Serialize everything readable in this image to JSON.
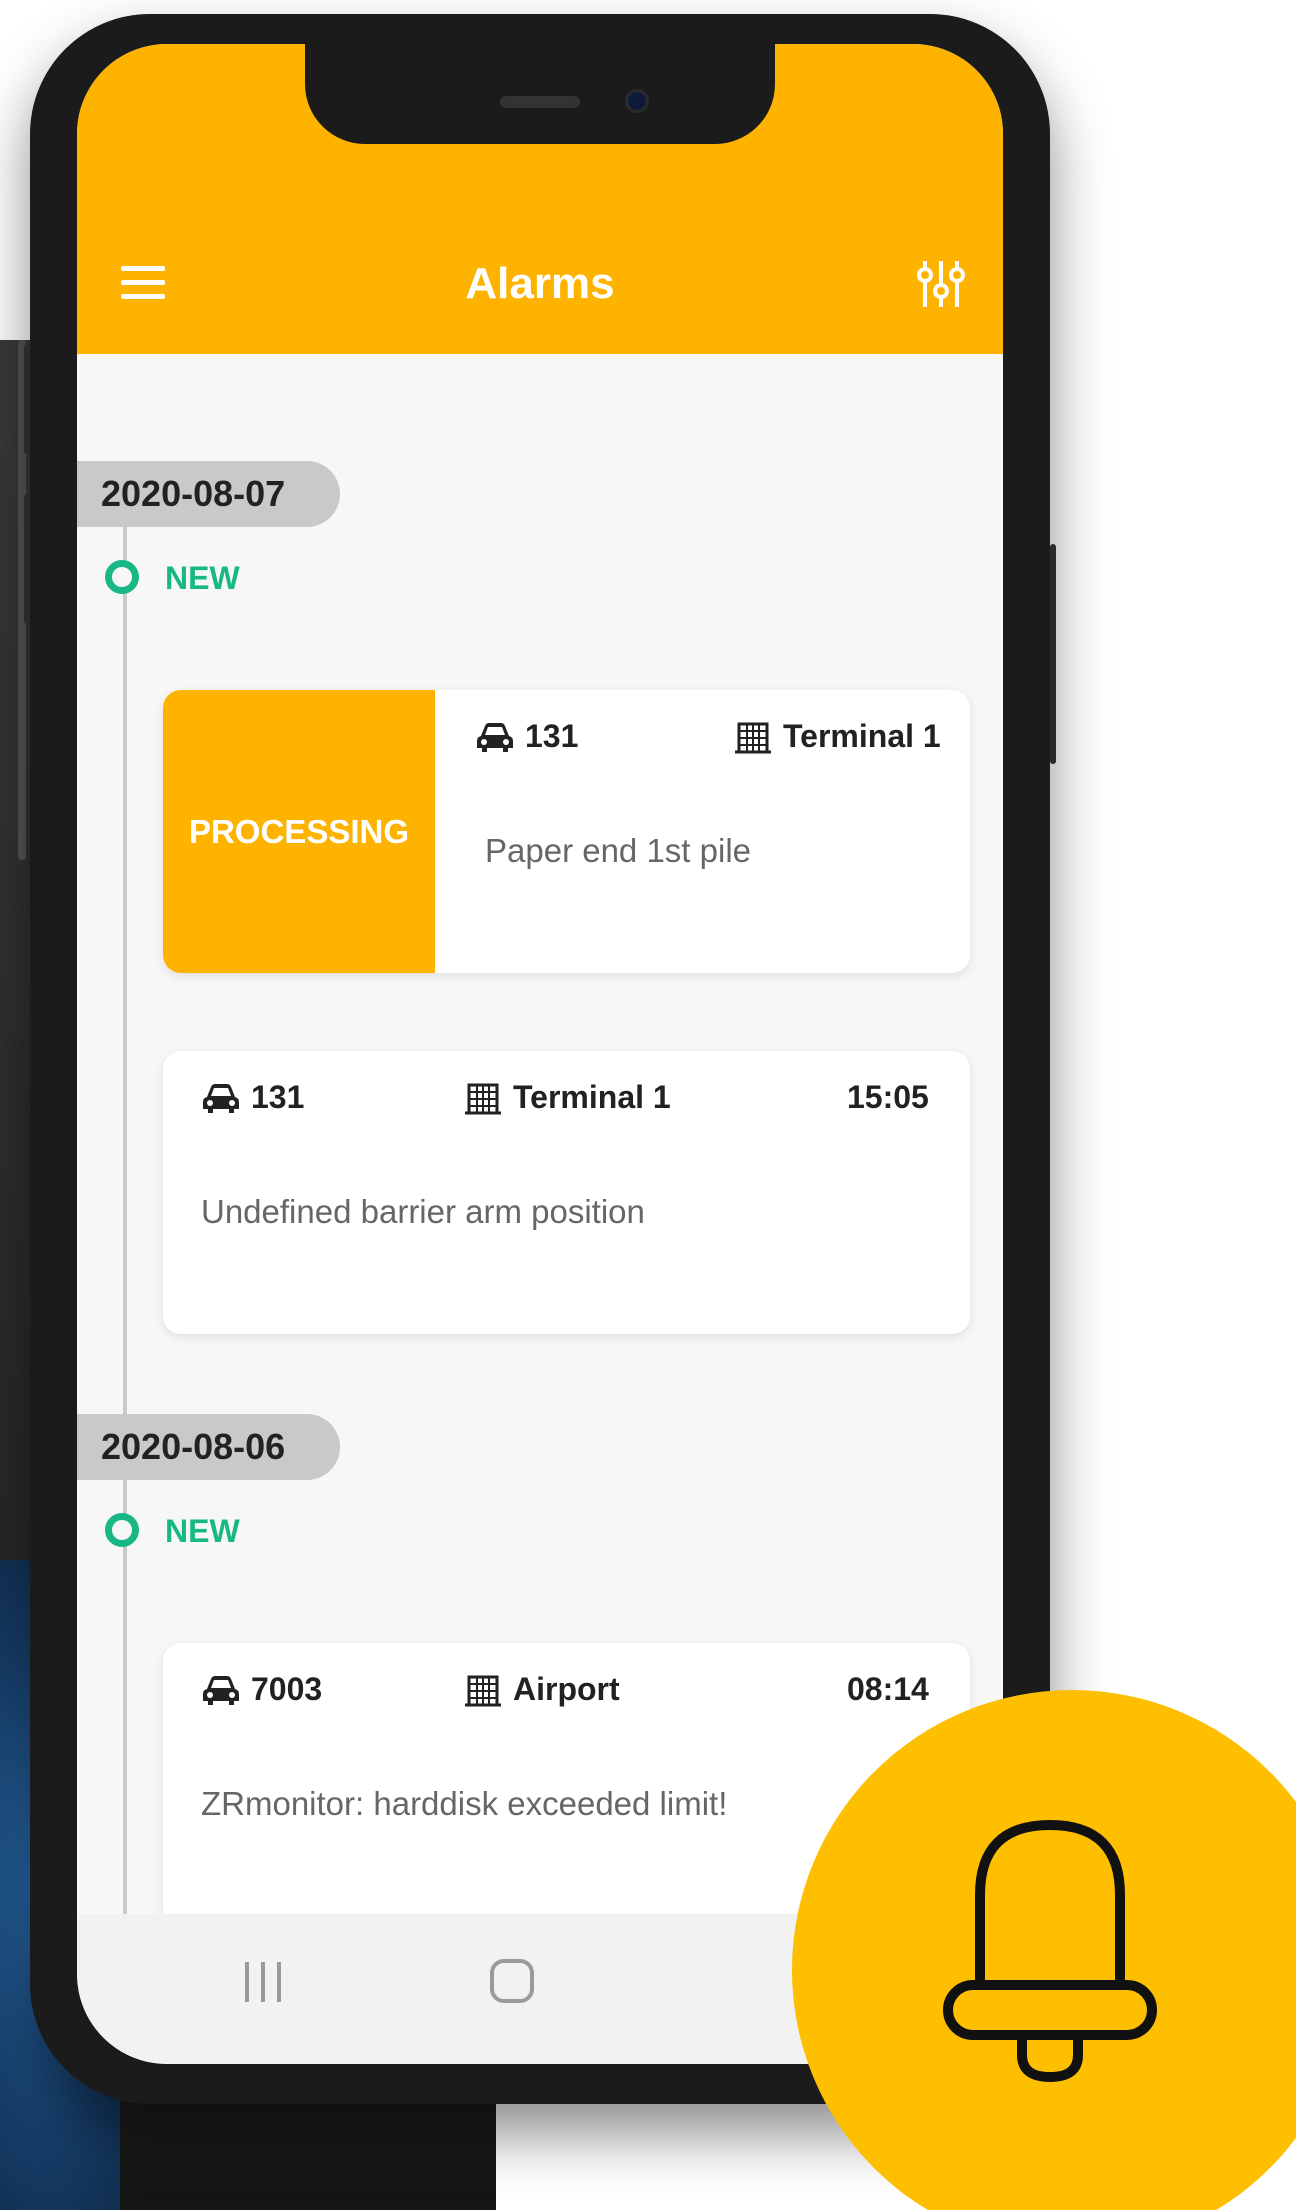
{
  "app": {
    "title": "Alarms",
    "accent_color": "#FDB300",
    "new_color": "#17B886"
  },
  "header": {
    "menu_icon": "hamburger-menu-icon",
    "filter_icon": "sliders-filter-icon"
  },
  "groups": [
    {
      "date": "2020-08-07",
      "status": "NEW",
      "cards": [
        {
          "badge": "PROCESSING",
          "vehicle": "131",
          "location": "Terminal 1",
          "time": "",
          "message": "Paper end 1st pile"
        },
        {
          "badge": "",
          "vehicle": "131",
          "location": "Terminal 1",
          "time": "15:05",
          "message": "Undefined barrier arm position"
        }
      ]
    },
    {
      "date": "2020-08-06",
      "status": "NEW",
      "cards": [
        {
          "badge": "",
          "vehicle": "7003",
          "location": "Airport",
          "time": "08:14",
          "message": "ZRmonitor: harddisk exceeded limit!"
        }
      ]
    }
  ],
  "icons": {
    "vehicle": "car-icon",
    "location": "building-icon",
    "badge": "bell-icon"
  },
  "navbar": {
    "items": [
      "recents-icon",
      "home-icon",
      "back-icon"
    ]
  }
}
